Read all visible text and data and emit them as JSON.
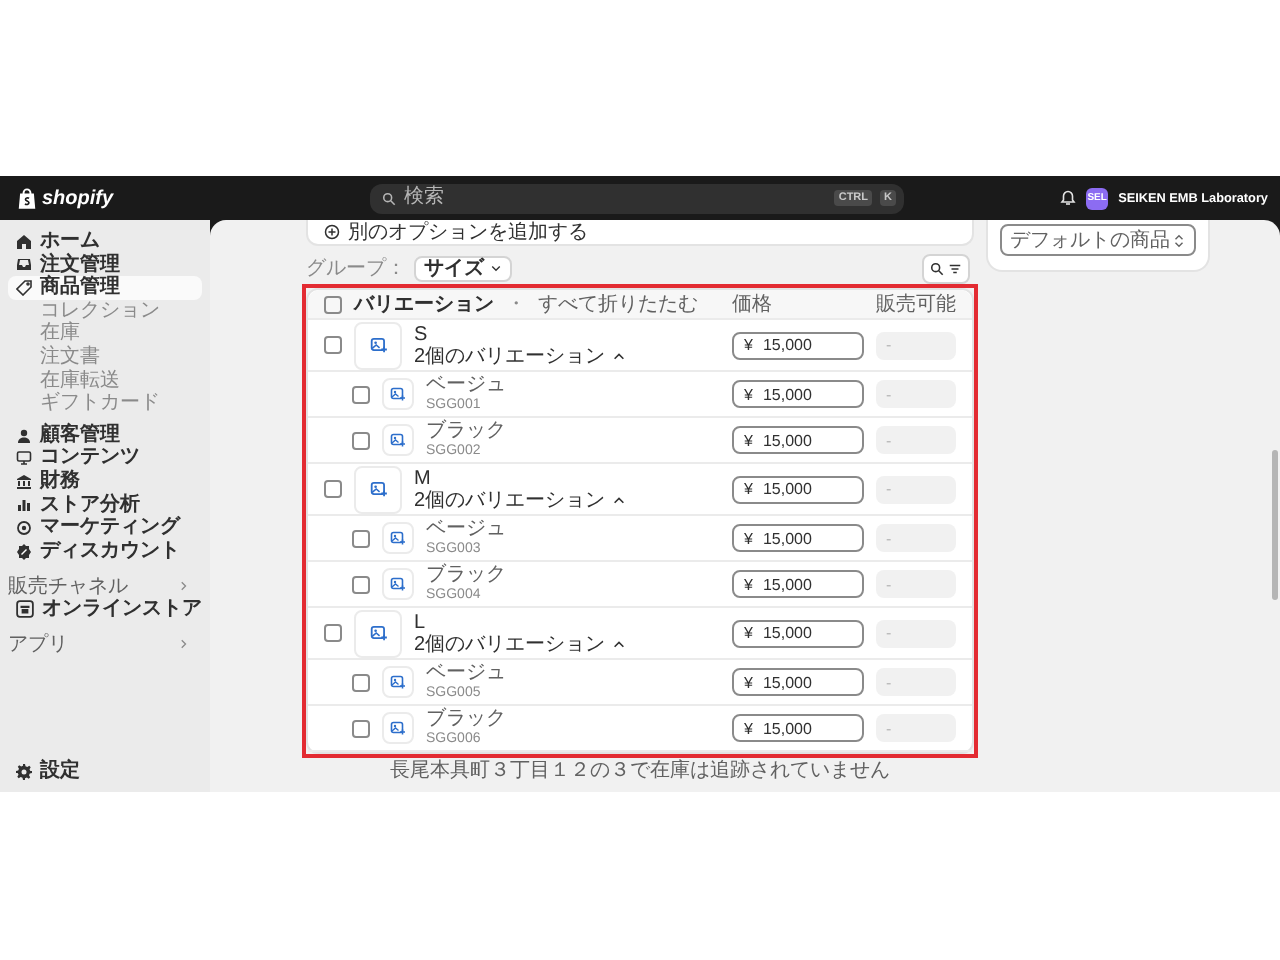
{
  "topbar": {
    "logo": "shopify",
    "search": {
      "placeholder": "検索",
      "shortcut": [
        "CTRL",
        "K"
      ]
    },
    "store": {
      "initials": "SEL",
      "name": "SEIKEN EMB Laboratory"
    }
  },
  "sidebar": {
    "items": [
      {
        "label": "ホーム",
        "kind": "main",
        "selected": false
      },
      {
        "label": "注文管理",
        "kind": "main",
        "selected": false
      },
      {
        "label": "商品管理",
        "kind": "main",
        "selected": true
      },
      {
        "label": "コレクション",
        "kind": "sub",
        "selected": false
      },
      {
        "label": "在庫",
        "kind": "sub",
        "selected": false
      },
      {
        "label": "注文書",
        "kind": "sub",
        "selected": false
      },
      {
        "label": "在庫転送",
        "kind": "sub",
        "selected": false
      },
      {
        "label": "ギフトカード",
        "kind": "sub",
        "selected": false
      },
      {
        "label": "顧客管理",
        "kind": "main",
        "selected": false
      },
      {
        "label": "コンテンツ",
        "kind": "main",
        "selected": false
      },
      {
        "label": "財務",
        "kind": "main",
        "selected": false
      },
      {
        "label": "ストア分析",
        "kind": "main",
        "selected": false
      },
      {
        "label": "マーケティング",
        "kind": "main",
        "selected": false
      },
      {
        "label": "ディスカウント",
        "kind": "main",
        "selected": false
      }
    ],
    "sections": [
      {
        "title": "販売チャネル",
        "items": [
          {
            "label": "オンラインストア",
            "selected": false
          }
        ]
      },
      {
        "title": "アプリ"
      }
    ],
    "settings": "設定"
  },
  "add_option": "別のオプションを追加する",
  "group_by": {
    "label": "グループ：",
    "value": "サイズ"
  },
  "table": {
    "header": {
      "label": "バリエーション",
      "separator": "・",
      "collapse_link": "すべて折りたたむ",
      "checked": false
    },
    "columns": [
      "価格",
      "販売可能"
    ],
    "groups": [
      {
        "name": "S",
        "summary": "2個のバリエーション",
        "expanded": true,
        "checked": false,
        "currency": "¥",
        "price": "15,000",
        "available": "-",
        "children": [
          {
            "name": "ベージュ",
            "sku": "SGG001",
            "checked": false,
            "currency": "¥",
            "price": "15,000",
            "available": "-"
          },
          {
            "name": "ブラック",
            "sku": "SGG002",
            "checked": false,
            "currency": "¥",
            "price": "15,000",
            "available": "-"
          }
        ]
      },
      {
        "name": "M",
        "summary": "2個のバリエーション",
        "expanded": true,
        "checked": false,
        "currency": "¥",
        "price": "15,000",
        "available": "-",
        "children": [
          {
            "name": "ベージュ",
            "sku": "SGG003",
            "checked": false,
            "currency": "¥",
            "price": "15,000",
            "available": "-"
          },
          {
            "name": "ブラック",
            "sku": "SGG004",
            "checked": false,
            "currency": "¥",
            "price": "15,000",
            "available": "-"
          }
        ]
      },
      {
        "name": "L",
        "summary": "2個のバリエーション",
        "expanded": true,
        "checked": false,
        "currency": "¥",
        "price": "15,000",
        "available": "-",
        "children": [
          {
            "name": "ベージュ",
            "sku": "SGG005",
            "checked": false,
            "currency": "¥",
            "price": "15,000",
            "available": "-"
          },
          {
            "name": "ブラック",
            "sku": "SGG006",
            "checked": false,
            "currency": "¥",
            "price": "15,000",
            "available": "-"
          }
        ]
      }
    ]
  },
  "footer_note": "長尾本具町３丁目１２の３で在庫は追跡されていません",
  "right_card": {
    "select": "デフォルトの商品"
  }
}
